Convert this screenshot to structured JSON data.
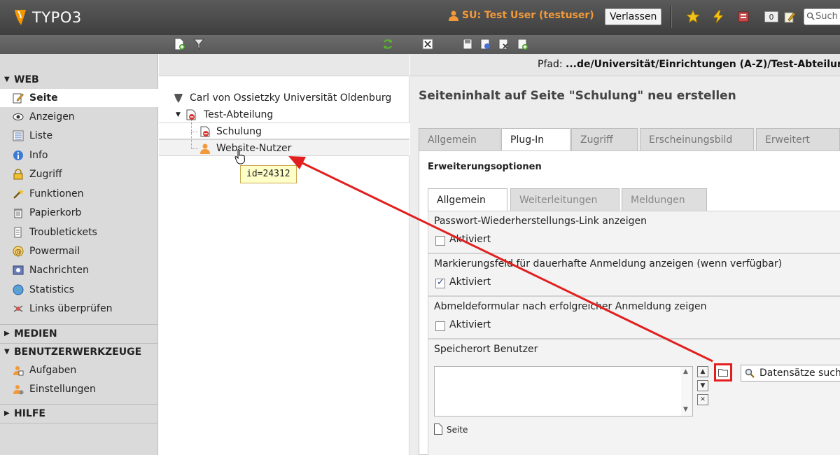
{
  "app": {
    "logo_text": "TYPO3"
  },
  "topbar": {
    "su_user": "SU: Test User (testuser)",
    "leave_button": "Verlassen",
    "counter": "0",
    "search_placeholder": "Such"
  },
  "modules": {
    "web_header": "WEB",
    "web_items": [
      {
        "label": "Seite",
        "icon": "pencil-page-icon"
      },
      {
        "label": "Anzeigen",
        "icon": "eye-icon"
      },
      {
        "label": "Liste",
        "icon": "list-icon"
      },
      {
        "label": "Info",
        "icon": "info-icon"
      },
      {
        "label": "Zugriff",
        "icon": "lock-icon"
      },
      {
        "label": "Funktionen",
        "icon": "wand-icon"
      },
      {
        "label": "Papierkorb",
        "icon": "trash-icon"
      },
      {
        "label": "Troubletickets",
        "icon": "ticket-icon"
      },
      {
        "label": "Powermail",
        "icon": "mail-icon"
      },
      {
        "label": "Nachrichten",
        "icon": "news-icon"
      },
      {
        "label": "Statistics",
        "icon": "globe-icon"
      },
      {
        "label": "Links überprüfen",
        "icon": "link-check-icon"
      }
    ],
    "medien_header": "MEDIEN",
    "tools_header": "BENUTZERWERKZEUGE",
    "tools_items": [
      {
        "label": "Aufgaben",
        "icon": "tasks-icon"
      },
      {
        "label": "Einstellungen",
        "icon": "settings-user-icon"
      }
    ],
    "help_header": "HILFE"
  },
  "tree": {
    "root": "Carl von Ossietzky Universität Oldenburg",
    "node1": "Test-Abteilung",
    "node2": "Schulung",
    "node3": "Website-Nutzer",
    "tooltip": "id=24312"
  },
  "content": {
    "path_label": "Pfad:",
    "path_value": "...de/Universität/Einrichtungen (A-Z)/Test-Abteilung",
    "heading": "Seiteninhalt auf Seite \"Schulung\" neu erstellen",
    "tabs": [
      "Allgemein",
      "Plug-In",
      "Zugriff",
      "Erscheinungsbild",
      "Erweitert"
    ],
    "active_tab": "Plug-In",
    "panel_title": "Erweiterungsoptionen",
    "subtabs": [
      "Allgemein",
      "Weiterleitungen",
      "Meldungen"
    ],
    "fields": {
      "pw_label": "Passwort-Wiederherstellungs-Link anzeigen",
      "pw_checkbox": "Aktiviert",
      "pw_checked": false,
      "remember_label": "Markierungsfeld für dauerhafte Anmeldung anzeigen (wenn verfügbar)",
      "remember_checkbox": "Aktiviert",
      "remember_checked": true,
      "logout_label": "Abmeldeformular nach erfolgreicher Anmeldung zeigen",
      "logout_checkbox": "Aktiviert",
      "logout_checked": false,
      "storage_label": "Speicherort Benutzer",
      "record_search": "Datensätze suchen",
      "page_ref": "Seite"
    }
  },
  "colors": {
    "accent_orange": "#f29a3a",
    "highlight_red": "#e21f1f",
    "topbar": "#4a4a4a"
  }
}
